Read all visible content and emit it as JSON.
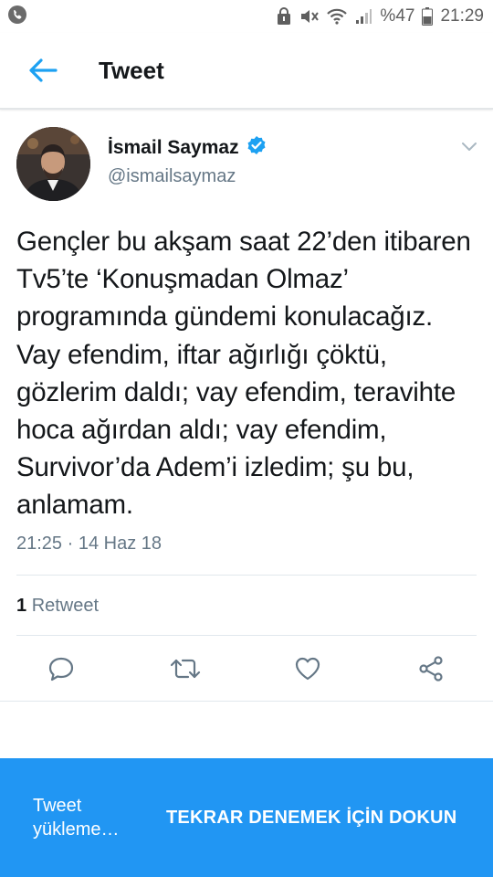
{
  "status_bar": {
    "battery_percent": "%47",
    "time": "21:29"
  },
  "app_bar": {
    "title": "Tweet"
  },
  "tweet": {
    "author_name": "İsmail Saymaz",
    "author_handle": "@ismailsaymaz",
    "verified": true,
    "text": "Gençler bu akşam saat 22’den itibaren Tv5’te ‘Konuşmadan Olmaz’ programında gündemi konulacağız. Vay efendim, iftar ağırlığı çöktü, gözlerim daldı; vay efendim, teravihte hoca ağırdan aldı; vay efendim, Survivor’da Adem’i izledim; şu bu, anlamam.",
    "timestamp": "21:25 · 14 Haz 18",
    "retweet_count": "1",
    "retweet_label": "Retweet"
  },
  "banner": {
    "status_text": "Tweet yükleme…",
    "action_text": "TEKRAR DENEMEK İÇİN DOKUN"
  },
  "colors": {
    "accent": "#1da1f2",
    "banner_bg": "#2196f3",
    "secondary_text": "#657786"
  }
}
